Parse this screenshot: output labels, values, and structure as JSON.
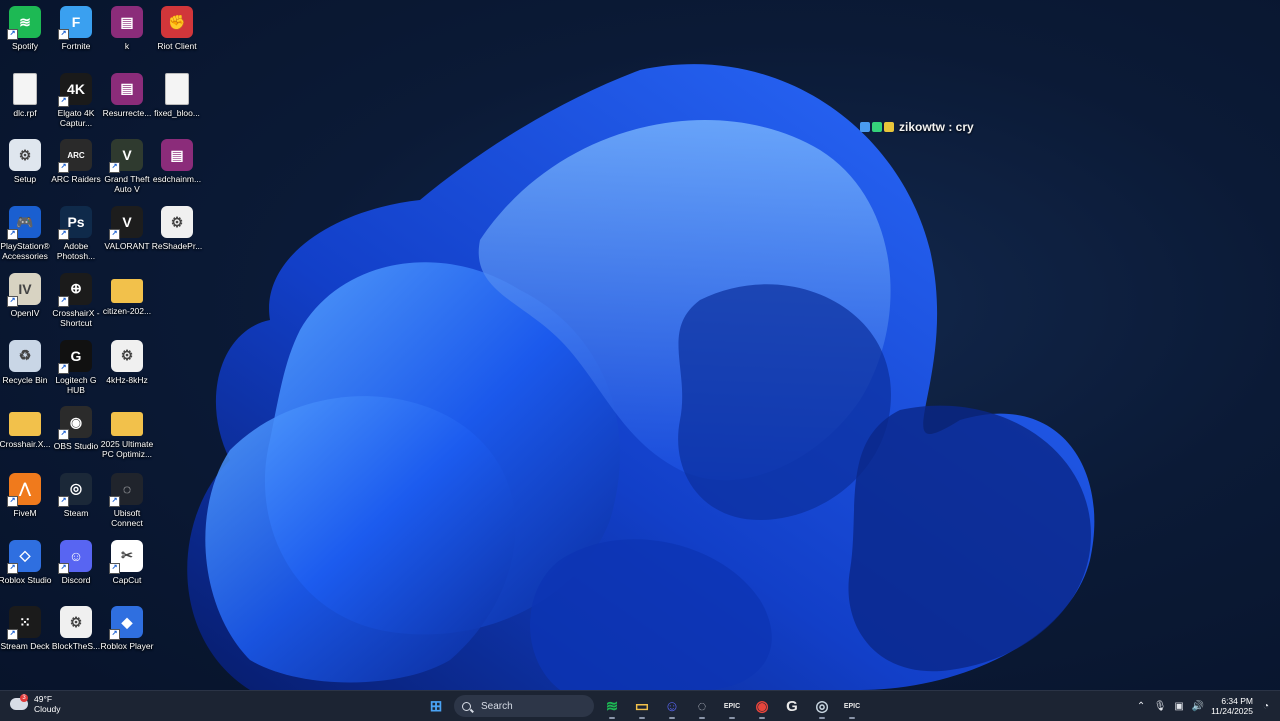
{
  "desktop_icons": [
    {
      "label": "Spotify",
      "icon": "spotify-icon",
      "color": "#1db954",
      "glyph": "≋",
      "shortcut": true
    },
    {
      "label": "Fortnite",
      "icon": "fortnite-icon",
      "color": "#3aa0f0",
      "glyph": "F",
      "shortcut": true
    },
    {
      "label": "k",
      "icon": "winrar-archive-icon",
      "color": "#8b2c7a",
      "glyph": "▤",
      "shortcut": false
    },
    {
      "label": "Riot Client",
      "icon": "riot-client-icon",
      "color": "#d1363a",
      "glyph": "✊",
      "shortcut": false
    },
    {
      "label": "dlc.rpf",
      "icon": "file-icon",
      "color": "#f4f4f4",
      "glyph": "",
      "shortcut": false
    },
    {
      "label": "Elgato 4K Captur...",
      "icon": "elgato-icon",
      "color": "#1a1a1a",
      "glyph": "4K",
      "shortcut": true
    },
    {
      "label": "Resurrecte...",
      "icon": "winrar-archive-icon",
      "color": "#8b2c7a",
      "glyph": "▤",
      "shortcut": false
    },
    {
      "label": "fixed_bloo...",
      "icon": "file-icon",
      "color": "#f4f4f4",
      "glyph": "",
      "shortcut": false
    },
    {
      "label": "Setup",
      "icon": "setup-icon",
      "color": "#dfe6ee",
      "glyph": "⚙",
      "shortcut": false
    },
    {
      "label": "ARC Raiders",
      "icon": "arc-raiders-icon",
      "color": "#2a2a2a",
      "glyph": "ARC",
      "shortcut": true
    },
    {
      "label": "Grand Theft Auto V",
      "icon": "gta-v-icon",
      "color": "#2f3a2f",
      "glyph": "V",
      "shortcut": true
    },
    {
      "label": "esdchainm...",
      "icon": "winrar-archive-icon",
      "color": "#8b2c7a",
      "glyph": "▤",
      "shortcut": false
    },
    {
      "label": "PlayStation® Accessories",
      "icon": "playstation-icon",
      "color": "#1a5fd0",
      "glyph": "🎮",
      "shortcut": true
    },
    {
      "label": "Adobe Photosh...",
      "icon": "photoshop-icon",
      "color": "#0f2a4a",
      "glyph": "Ps",
      "shortcut": true
    },
    {
      "label": "VALORANT",
      "icon": "valorant-icon",
      "color": "#1d1d1d",
      "glyph": "V",
      "shortcut": true
    },
    {
      "label": "ReShadePr...",
      "icon": "settings-file-icon",
      "color": "#f0f0f0",
      "glyph": "⚙",
      "shortcut": false
    },
    {
      "label": "OpenIV",
      "icon": "openiv-icon",
      "color": "#d8d3c2",
      "glyph": "IV",
      "shortcut": true
    },
    {
      "label": "CrosshairX - Shortcut",
      "icon": "crosshairx-icon",
      "color": "#1b1b1b",
      "glyph": "⊕",
      "shortcut": true
    },
    {
      "label": "citizen-202...",
      "icon": "folder-icon",
      "color": "#f2c14b",
      "glyph": "",
      "shortcut": false
    },
    {
      "label": "",
      "icon": "",
      "color": "",
      "glyph": "",
      "shortcut": false
    },
    {
      "label": "Recycle Bin",
      "icon": "recycle-bin-icon",
      "color": "#c9d6e6",
      "glyph": "♻",
      "shortcut": false
    },
    {
      "label": "Logitech G HUB",
      "icon": "logitech-icon",
      "color": "#111111",
      "glyph": "G",
      "shortcut": true
    },
    {
      "label": "4kHz-8kHz",
      "icon": "settings-file-icon",
      "color": "#f0f0f0",
      "glyph": "⚙",
      "shortcut": false
    },
    {
      "label": "",
      "icon": "",
      "color": "",
      "glyph": "",
      "shortcut": false
    },
    {
      "label": "Crosshair.X...",
      "icon": "folder-icon",
      "color": "#f2c14b",
      "glyph": "",
      "shortcut": false
    },
    {
      "label": "OBS Studio",
      "icon": "obs-icon",
      "color": "#2b2b2b",
      "glyph": "◉",
      "shortcut": true
    },
    {
      "label": "2025 Ultimate PC Optimiz...",
      "icon": "folder-icon",
      "color": "#f2c14b",
      "glyph": "",
      "shortcut": false
    },
    {
      "label": "",
      "icon": "",
      "color": "",
      "glyph": "",
      "shortcut": false
    },
    {
      "label": "FiveM",
      "icon": "fivem-icon",
      "color": "#f07a1c",
      "glyph": "⋀",
      "shortcut": true
    },
    {
      "label": "Steam",
      "icon": "steam-icon",
      "color": "#1b2838",
      "glyph": "◎",
      "shortcut": true
    },
    {
      "label": "Ubisoft Connect",
      "icon": "ubisoft-icon",
      "color": "#20242c",
      "glyph": "◌",
      "shortcut": true
    },
    {
      "label": "",
      "icon": "",
      "color": "",
      "glyph": "",
      "shortcut": false
    },
    {
      "label": "Roblox Studio",
      "icon": "roblox-studio-icon",
      "color": "#2f6fe0",
      "glyph": "◇",
      "shortcut": true
    },
    {
      "label": "Discord",
      "icon": "discord-icon",
      "color": "#5865f2",
      "glyph": "☺",
      "shortcut": true
    },
    {
      "label": "CapCut",
      "icon": "capcut-icon",
      "color": "#ffffff",
      "glyph": "✂",
      "shortcut": true
    },
    {
      "label": "",
      "icon": "",
      "color": "",
      "glyph": "",
      "shortcut": false
    },
    {
      "label": "Stream Deck",
      "icon": "stream-deck-icon",
      "color": "#1b1b1b",
      "glyph": "⁙",
      "shortcut": true
    },
    {
      "label": "BlockTheS...",
      "icon": "settings-file-icon",
      "color": "#f0f0f0",
      "glyph": "⚙",
      "shortcut": false
    },
    {
      "label": "Roblox Player",
      "icon": "roblox-player-icon",
      "color": "#2f6fe0",
      "glyph": "◆",
      "shortcut": true
    }
  ],
  "overlay": {
    "text": "zikowtw : cry"
  },
  "taskbar": {
    "weather": {
      "temp": "49°F",
      "condition": "Cloudy",
      "alert_count": "3"
    },
    "search": {
      "placeholder": "Search"
    },
    "pinned": [
      {
        "name": "start-button",
        "glyph": "⊞",
        "color": "#4aa3f5",
        "running": false
      },
      {
        "name": "taskbar-spotify",
        "glyph": "≋",
        "color": "#1db954",
        "running": true
      },
      {
        "name": "taskbar-file-explorer",
        "glyph": "▭",
        "color": "#f2c14b",
        "running": true
      },
      {
        "name": "taskbar-discord",
        "glyph": "☺",
        "color": "#5865f2",
        "running": true
      },
      {
        "name": "taskbar-app-running",
        "glyph": "◌",
        "color": "#c9ced8",
        "running": true
      },
      {
        "name": "taskbar-epic-games",
        "glyph": "EPIC",
        "color": "#e9e9e9",
        "running": true
      },
      {
        "name": "taskbar-chrome",
        "glyph": "◉",
        "color": "#e8453c",
        "running": true
      },
      {
        "name": "taskbar-logitech",
        "glyph": "G",
        "color": "#e9e9e9",
        "running": false
      },
      {
        "name": "taskbar-steam",
        "glyph": "◎",
        "color": "#c7d5e0",
        "running": true
      },
      {
        "name": "taskbar-epic-games-2",
        "glyph": "EPIC",
        "color": "#e9e9e9",
        "running": true
      }
    ],
    "clock": {
      "time": "6:34 PM",
      "date": "11/24/2025"
    }
  }
}
